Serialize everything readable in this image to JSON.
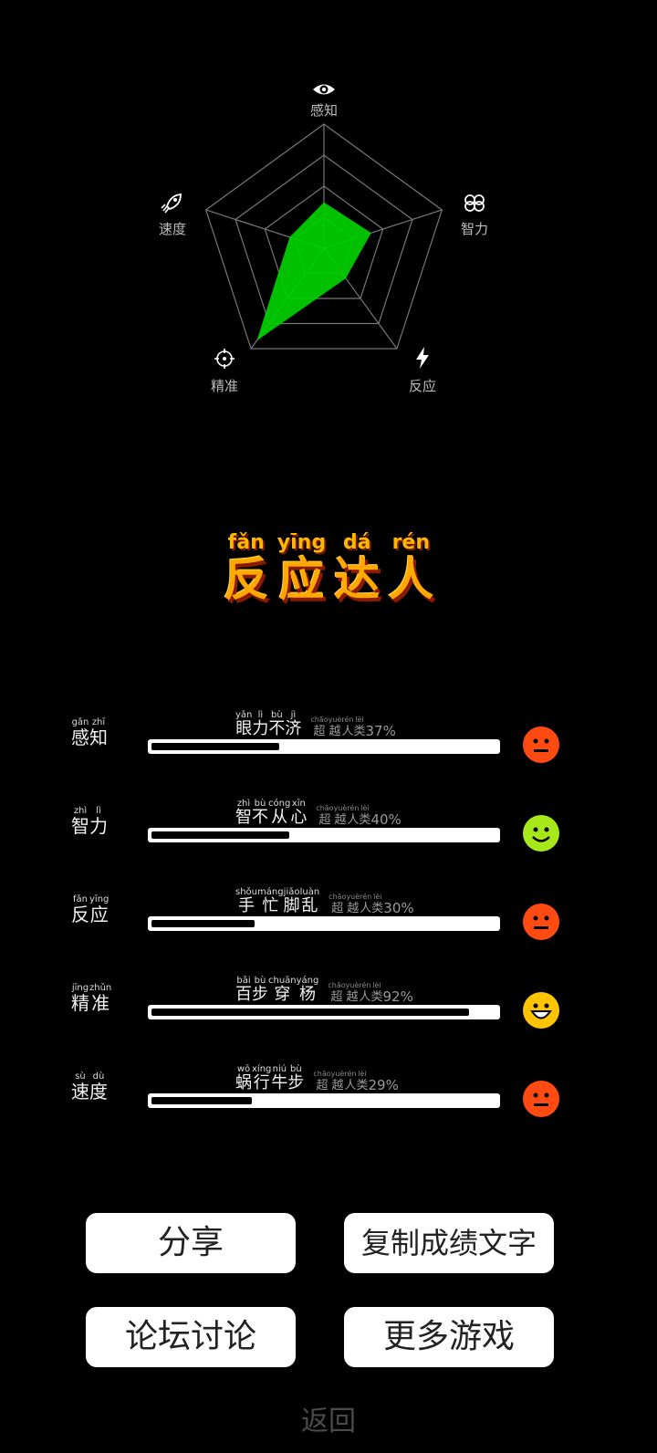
{
  "radar": {
    "axes": [
      {
        "name": "感知",
        "icon": "eye-icon",
        "value": 0.37
      },
      {
        "name": "智力",
        "icon": "brain-icon",
        "value": 0.4
      },
      {
        "name": "反应",
        "icon": "lightning-icon",
        "value": 0.3
      },
      {
        "name": "精准",
        "icon": "target-icon",
        "value": 0.92
      },
      {
        "name": "速度",
        "icon": "rocket-icon",
        "value": 0.29
      }
    ],
    "fill_color": "#00d000",
    "grid_color": "#777777"
  },
  "title": {
    "chars": [
      "反",
      "应",
      "达",
      "人"
    ],
    "pinyin": [
      "fǎn",
      "yīng",
      "dá",
      "rén"
    ]
  },
  "stats": [
    {
      "cat_chars": [
        "感",
        "知"
      ],
      "cat_pinyin": [
        "gǎn",
        "zhī"
      ],
      "desc_chars": [
        "眼",
        "力",
        "不",
        "济"
      ],
      "desc_pinyin": [
        "yǎn",
        "lì",
        "bù",
        "jì"
      ],
      "pct_chars": [
        "超",
        "越",
        "人",
        "类"
      ],
      "pct_pinyin": [
        "chāo",
        "yuè",
        "rén",
        "lèi"
      ],
      "percent_text": "37%",
      "percent": 37,
      "face": "neutral",
      "face_color": "#ff4a12"
    },
    {
      "cat_chars": [
        "智",
        "力"
      ],
      "cat_pinyin": [
        "zhì",
        "lì"
      ],
      "desc_chars": [
        "智",
        "不",
        "从",
        "心"
      ],
      "desc_pinyin": [
        "zhì",
        "bù",
        "cóng",
        "xīn"
      ],
      "pct_chars": [
        "超",
        "越",
        "人",
        "类"
      ],
      "pct_pinyin": [
        "chāo",
        "yuè",
        "rén",
        "lèi"
      ],
      "percent_text": "40%",
      "percent": 40,
      "face": "smile",
      "face_color": "#a7e81a"
    },
    {
      "cat_chars": [
        "反",
        "应"
      ],
      "cat_pinyin": [
        "fǎn",
        "yīng"
      ],
      "desc_chars": [
        "手",
        "忙",
        "脚",
        "乱"
      ],
      "desc_pinyin": [
        "shǒu",
        "máng",
        "jiǎo",
        "luàn"
      ],
      "pct_chars": [
        "超",
        "越",
        "人",
        "类"
      ],
      "pct_pinyin": [
        "chāo",
        "yuè",
        "rén",
        "lèi"
      ],
      "percent_text": "30%",
      "percent": 30,
      "face": "neutral",
      "face_color": "#ff4a12"
    },
    {
      "cat_chars": [
        "精",
        "准"
      ],
      "cat_pinyin": [
        "jīng",
        "zhǔn"
      ],
      "desc_chars": [
        "百",
        "步",
        "穿",
        "杨"
      ],
      "desc_pinyin": [
        "bǎi",
        "bù",
        "chuān",
        "yáng"
      ],
      "pct_chars": [
        "超",
        "越",
        "人",
        "类"
      ],
      "pct_pinyin": [
        "chāo",
        "yuè",
        "rén",
        "lèi"
      ],
      "percent_text": "92%",
      "percent": 92,
      "face": "grin",
      "face_color": "#ffc400"
    },
    {
      "cat_chars": [
        "速",
        "度"
      ],
      "cat_pinyin": [
        "sù",
        "dù"
      ],
      "desc_chars": [
        "蜗",
        "行",
        "牛",
        "步"
      ],
      "desc_pinyin": [
        "wō",
        "xíng",
        "niú",
        "bù"
      ],
      "pct_chars": [
        "超",
        "越",
        "人",
        "类"
      ],
      "pct_pinyin": [
        "chāo",
        "yuè",
        "rén",
        "lèi"
      ],
      "percent_text": "29%",
      "percent": 29,
      "face": "neutral",
      "face_color": "#ff4a12"
    }
  ],
  "buttons": {
    "share": "分享",
    "copy": "复制成绩文字",
    "forum": "论坛讨论",
    "more": "更多游戏"
  },
  "back": "返回"
}
